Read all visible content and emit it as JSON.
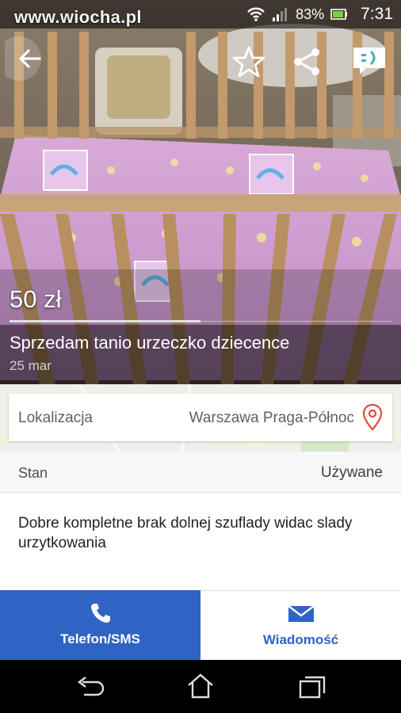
{
  "status_bar": {
    "watermark": "www.wiocha.pl",
    "battery": "83%",
    "time": "7:31"
  },
  "listing": {
    "price": "50 zł",
    "title": "Sprzedam tanio urzeczko dziecence",
    "date": "25  mar"
  },
  "location": {
    "label": "Lokalizacja",
    "value": "Warszawa Praga-Północ"
  },
  "condition": {
    "label": "Stan",
    "value": "Używane"
  },
  "description": "Dobre kompletne brak dolnej szuflady widac slady urzytkowania",
  "actions": {
    "phone_label": "Telefon/SMS",
    "message_label": "Wiadomość"
  },
  "colors": {
    "primary_blue": "#2f64c4",
    "pin_red": "#e5483c"
  },
  "icons": [
    "back-arrow-icon",
    "star-icon",
    "share-icon",
    "chat-icon",
    "location-pin-icon",
    "phone-icon",
    "envelope-icon",
    "nav-back-icon",
    "nav-home-icon",
    "nav-recents-icon"
  ]
}
